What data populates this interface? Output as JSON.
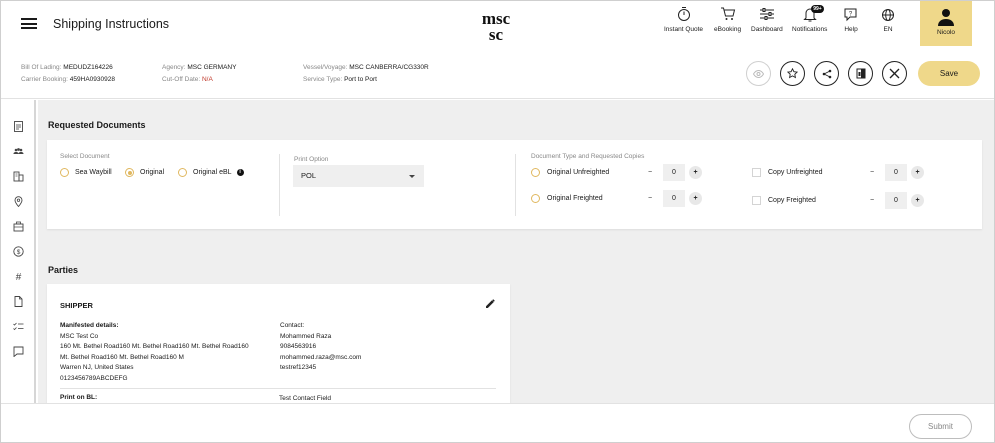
{
  "header": {
    "title": "Shipping Instructions",
    "logo_text": "msc",
    "nav": [
      {
        "label": "Instant Quote",
        "icon": "stopwatch-icon"
      },
      {
        "label": "eBooking",
        "icon": "cart-icon"
      },
      {
        "label": "Dashboard",
        "icon": "sliders-icon"
      },
      {
        "label": "Notifications",
        "icon": "bell-icon",
        "badge": "99+"
      },
      {
        "label": "Help",
        "icon": "help-chat-icon"
      },
      {
        "label": "EN",
        "icon": "globe-icon"
      }
    ],
    "user": {
      "name": "Nicolo",
      "icon": "user-icon"
    },
    "accent": "#efd88a"
  },
  "info": {
    "bill_of_lading": {
      "label": "Bill Of Lading:",
      "value": "MEDUDZ164226"
    },
    "carrier_booking": {
      "label": "Carrier Booking:",
      "value": "459HA0930928"
    },
    "agency": {
      "label": "Agency:",
      "value": "MSC GERMANY"
    },
    "cutoff": {
      "label": "Cut-Off Date:",
      "value": "N/A"
    },
    "vessel": {
      "label": "Vessel/Voyage:",
      "value": "MSC CANBERRA/CG330R"
    },
    "service": {
      "label": "Service Type:",
      "value": "Port to Port"
    },
    "save_label": "Save",
    "actions": [
      "eye-icon",
      "star-icon",
      "share-icon",
      "compare-icon",
      "close-icon"
    ]
  },
  "rail_icons": [
    "document-icon",
    "people-icon",
    "building-icon",
    "location-icon",
    "briefcase-icon",
    "dollar-icon",
    "hash-icon",
    "file-icon",
    "checklist-icon",
    "comment-icon"
  ],
  "requested_documents": {
    "title": "Requested Documents",
    "select_label": "Select Document",
    "options": [
      {
        "label": "Sea Waybill",
        "selected": false
      },
      {
        "label": "Original",
        "selected": true
      },
      {
        "label": "Original eBL",
        "selected": false
      }
    ],
    "print_option_label": "Print Option",
    "print_option_value": "POL",
    "doc_type_label": "Document Type and Requested Copies",
    "doc_types": [
      {
        "label": "Original Unfreighted",
        "value": "0"
      },
      {
        "label": "Original Freighted",
        "value": "0"
      },
      {
        "label": "Copy Unfreighted",
        "value": "0"
      },
      {
        "label": "Copy Freighted",
        "value": "0"
      }
    ],
    "minus": "−",
    "plus": "+"
  },
  "parties": {
    "title": "Parties",
    "shipper": {
      "heading": "SHIPPER",
      "manifested_label": "Manifested details:",
      "lines": [
        "MSC Test Co",
        "160 Mt. Bethel Road160 Mt. Bethel Road160 Mt. Bethel Road160",
        "Mt. Bethel Road160 Mt. Bethel Road160 M",
        "Warren NJ, United States",
        "0123456789ABCDEFG"
      ],
      "contact_label": "Contact:",
      "contact_lines": [
        "Mohammed Raza",
        "9084563916",
        "mohammed.raza@msc.com",
        "testref12345"
      ],
      "print_on_bl_label": "Print on BL:",
      "test_contact_field": "Test Contact Field"
    }
  },
  "footer": {
    "submit_label": "Submit"
  }
}
